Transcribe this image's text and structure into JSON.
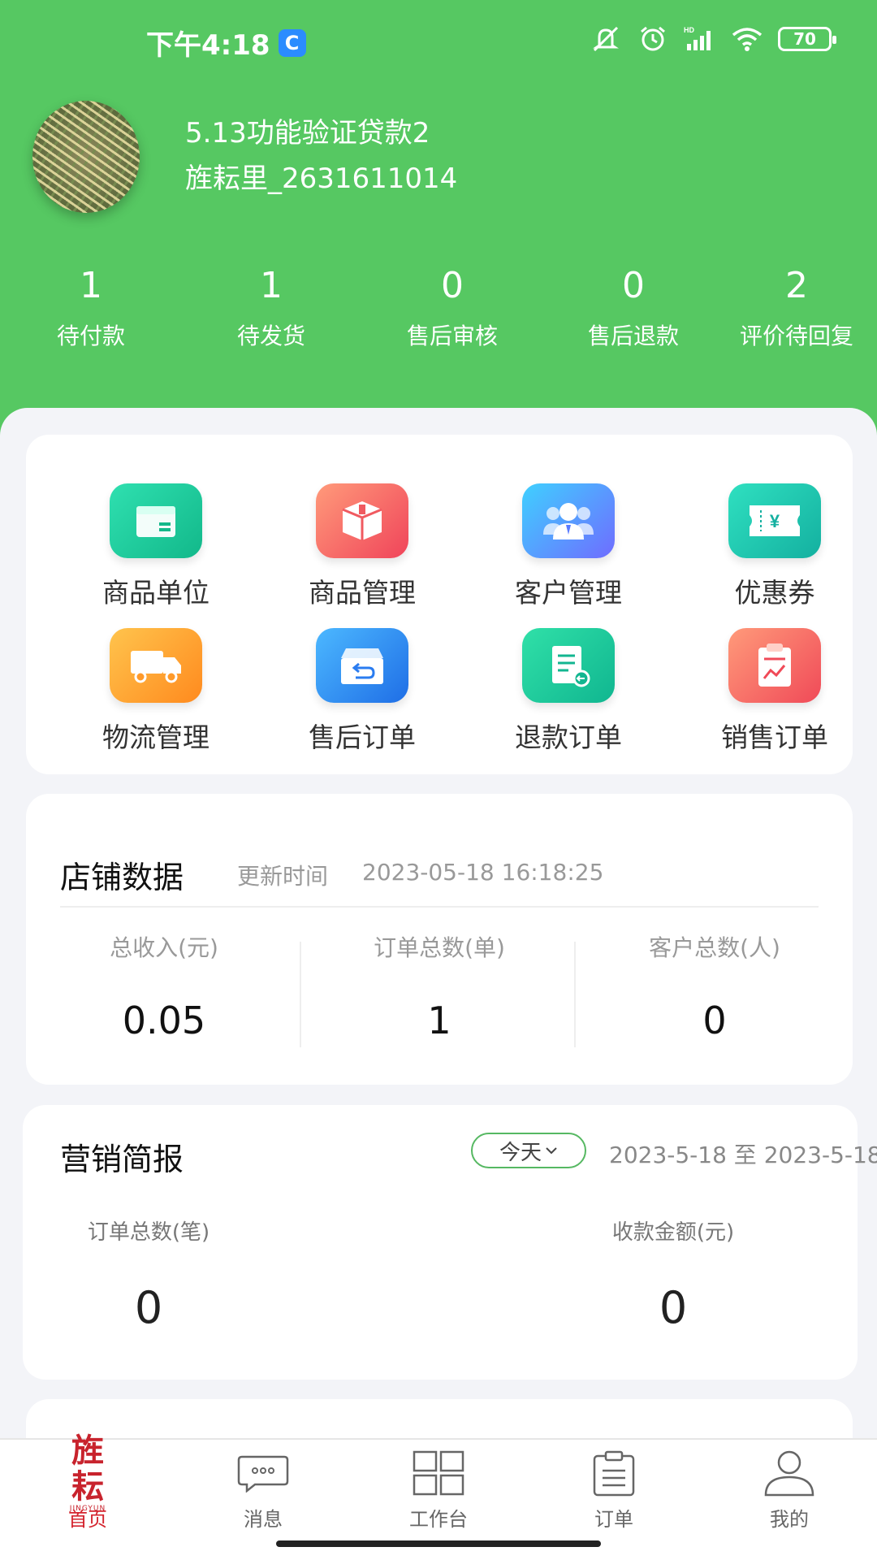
{
  "status_bar": {
    "time": "下午4:18",
    "app_badge": "C",
    "battery": "70"
  },
  "profile": {
    "shop_name": "5.13功能验证贷款2",
    "account": "旌耘里_2631611014"
  },
  "order_stats": [
    {
      "value": "1",
      "label": "待付款"
    },
    {
      "value": "1",
      "label": "待发货"
    },
    {
      "value": "0",
      "label": "售后审核"
    },
    {
      "value": "0",
      "label": "售后退款"
    },
    {
      "value": "2",
      "label": "评价待回复"
    }
  ],
  "menu": [
    {
      "label": "商品单位",
      "icon": "box-icon"
    },
    {
      "label": "商品管理",
      "icon": "package-icon"
    },
    {
      "label": "客户管理",
      "icon": "users-icon"
    },
    {
      "label": "优惠券",
      "icon": "coupon-icon"
    },
    {
      "label": "物流管理",
      "icon": "truck-icon"
    },
    {
      "label": "售后订单",
      "icon": "return-box-icon"
    },
    {
      "label": "退款订单",
      "icon": "refund-doc-icon"
    },
    {
      "label": "销售订单",
      "icon": "sales-clipboard-icon"
    }
  ],
  "store_data": {
    "title": "店铺数据",
    "update_label": "更新时间",
    "update_time": "2023-05-18 16:18:25",
    "metrics": [
      {
        "label": "总收入(元)",
        "value": "0.05"
      },
      {
        "label": "订单总数(单)",
        "value": "1"
      },
      {
        "label": "客户总数(人)",
        "value": "0"
      }
    ]
  },
  "marketing": {
    "title": "营销简报",
    "period_button": "今天",
    "date_range": "2023-5-18 至 2023-5-18",
    "metrics": [
      {
        "label": "订单总数(笔)",
        "value": "0"
      },
      {
        "label": "收款金额(元)",
        "value": "0"
      }
    ]
  },
  "tabbar": {
    "logo_text": "旌耘",
    "logo_sub": "JINGYUN",
    "tabs": [
      {
        "label": "首页",
        "active": true
      },
      {
        "label": "消息",
        "active": false
      },
      {
        "label": "工作台",
        "active": false
      },
      {
        "label": "订单",
        "active": false
      },
      {
        "label": "我的",
        "active": false
      }
    ]
  },
  "colors": {
    "header_green": "#56c862",
    "active_tab_red": "#d4242e"
  }
}
